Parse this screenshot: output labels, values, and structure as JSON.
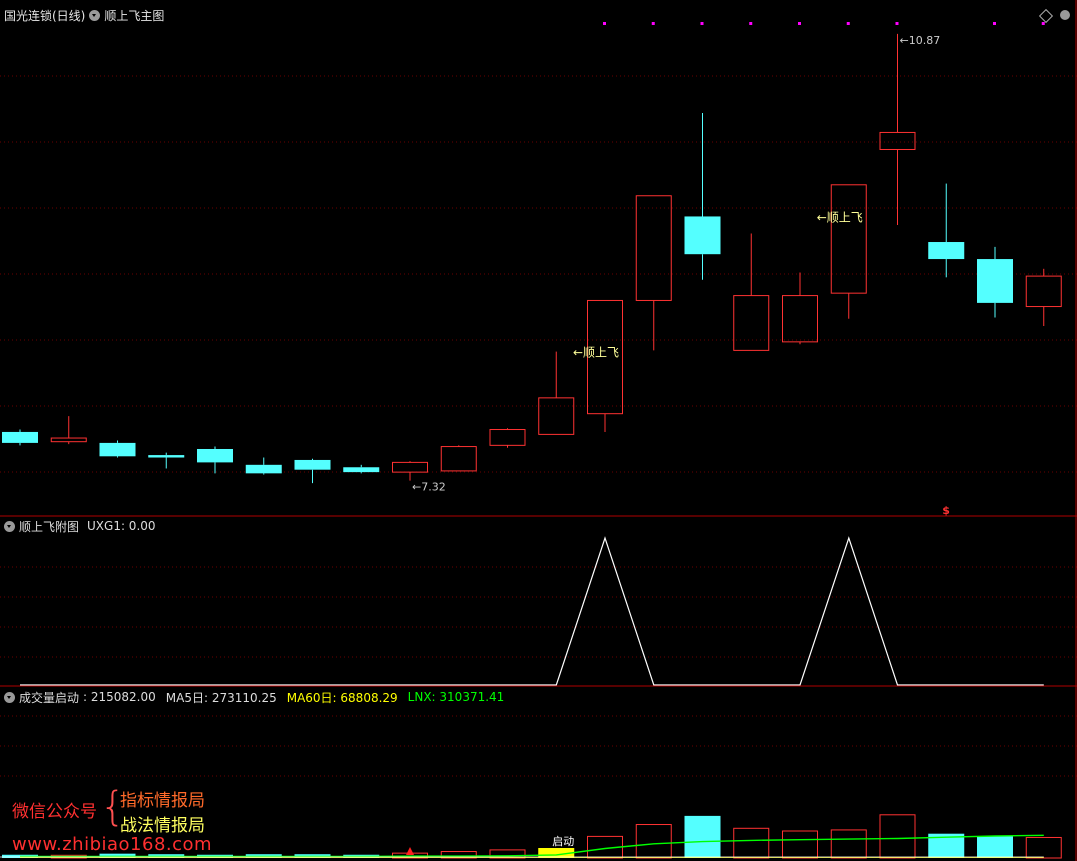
{
  "main_panel": {
    "stock_name": "国光连锁(日线)",
    "indicator_name": "顺上飞主图",
    "high_label": "10.87",
    "low_label": "7.32",
    "signal_label": "顺上飞",
    "dollar_marker": "$"
  },
  "sub_panel": {
    "title": "顺上飞附图",
    "value_text": "UXG1: 0.00"
  },
  "volume_panel": {
    "title": "成交量启动",
    "value": ": 215082.00",
    "ma5": "MA5日: 273110.25",
    "ma60": "MA60日: 68808.29",
    "lnx": "LNX: 310371.41",
    "start_label": "启动"
  },
  "watermark": {
    "wechat_label": "微信公众号",
    "brace": "{",
    "line1": "指标情报局",
    "line2": "战法情报局",
    "url": "www.zhibiao168.com"
  },
  "colors": {
    "background": "#000000",
    "up": "#ff3232",
    "down": "#54ffff",
    "border": "#b00000",
    "grid": "#6a0000",
    "magenta": "#ff00ff",
    "text": "#dddddd",
    "ma60": "#ffff00",
    "lnx": "#00ff00",
    "watermark_red": "#ff3030",
    "watermark_yellow": "#ffff60"
  },
  "chart_data": [
    {
      "type": "candlestick",
      "title": "顺上飞主图",
      "candles": [
        {
          "open": 7.6,
          "close": 7.51,
          "high": 7.62,
          "low": 7.49
        },
        {
          "open": 7.52,
          "close": 7.55,
          "high": 7.73,
          "low": 7.5
        },
        {
          "open": 7.51,
          "close": 7.4,
          "high": 7.53,
          "low": 7.39
        },
        {
          "open": 7.41,
          "close": 7.39,
          "high": 7.43,
          "low": 7.3
        },
        {
          "open": 7.46,
          "close": 7.35,
          "high": 7.48,
          "low": 7.26
        },
        {
          "open": 7.33,
          "close": 7.26,
          "high": 7.39,
          "low": 7.25
        },
        {
          "open": 7.37,
          "close": 7.29,
          "high": 7.38,
          "low": 7.18
        },
        {
          "open": 7.31,
          "close": 7.27,
          "high": 7.33,
          "low": 7.26
        },
        {
          "open": 7.27,
          "close": 7.35,
          "high": 7.36,
          "low": 7.2
        },
        {
          "open": 7.28,
          "close": 7.48,
          "high": 7.49,
          "low": 7.28
        },
        {
          "open": 7.49,
          "close": 7.62,
          "high": 7.63,
          "low": 7.47
        },
        {
          "open": 7.58,
          "close": 7.88,
          "high": 8.26,
          "low": 7.58
        },
        {
          "open": 7.75,
          "close": 8.68,
          "high": 8.68,
          "low": 7.6
        },
        {
          "open": 8.68,
          "close": 9.54,
          "high": 9.54,
          "low": 8.27
        },
        {
          "open": 9.37,
          "close": 9.06,
          "high": 10.22,
          "low": 8.85
        },
        {
          "open": 8.27,
          "close": 8.72,
          "high": 9.23,
          "low": 8.27
        },
        {
          "open": 8.34,
          "close": 8.72,
          "high": 8.91,
          "low": 8.32
        },
        {
          "open": 8.74,
          "close": 9.63,
          "high": 9.63,
          "low": 8.53
        },
        {
          "open": 9.92,
          "close": 10.06,
          "high": 10.87,
          "low": 9.3
        },
        {
          "open": 9.16,
          "close": 9.02,
          "high": 9.64,
          "low": 8.87
        },
        {
          "open": 9.02,
          "close": 8.66,
          "high": 9.12,
          "low": 8.54
        },
        {
          "open": 8.63,
          "close": 8.88,
          "high": 8.94,
          "low": 8.47
        }
      ],
      "annotations": [
        {
          "index": 8,
          "text": "7.32",
          "value": 7.2
        },
        {
          "index": 18,
          "text": "10.87",
          "value": 10.87
        },
        {
          "index": 12,
          "text": "顺上飞",
          "value": 8.26
        },
        {
          "index": 17,
          "text": "顺上飞",
          "value": 9.37
        }
      ],
      "top_marker_indices": [
        12,
        13,
        14,
        15,
        16,
        17,
        18,
        20,
        21
      ],
      "dollar_marker_index": 19
    },
    {
      "type": "line",
      "title": "顺上飞附图",
      "series": [
        {
          "name": "UXG1",
          "values": [
            0,
            0,
            0,
            0,
            0,
            0,
            0,
            0,
            0,
            0,
            0,
            0,
            1,
            0,
            0,
            0,
            0,
            1,
            0,
            0,
            0,
            0
          ]
        }
      ]
    },
    {
      "type": "bar",
      "title": "成交量启动",
      "bars_relative": [
        0.06,
        0.05,
        0.08,
        0.07,
        0.06,
        0.07,
        0.07,
        0.06,
        0.09,
        0.12,
        0.15,
        0.2,
        0.4,
        0.62,
        0.78,
        0.55,
        0.5,
        0.52,
        0.8,
        0.45,
        0.4,
        0.38
      ],
      "bar_colors": [
        "down",
        "up",
        "down",
        "down",
        "down",
        "down",
        "down",
        "down",
        "up",
        "up",
        "up",
        "up",
        "up",
        "up",
        "down",
        "up",
        "up",
        "up",
        "up",
        "down",
        "down",
        "up"
      ],
      "series": [
        {
          "name": "MA60日",
          "values": [
            0.02,
            0.02,
            0.02,
            0.02,
            0.02,
            0.02,
            0.02,
            0.02,
            0.02,
            0.02,
            0.02,
            0.02,
            0.02,
            0.02,
            0.02,
            0.02,
            0.02,
            0.02,
            0.02,
            0.02,
            0.02,
            0.02
          ]
        },
        {
          "name": "LNX",
          "values": [
            0.05,
            0.05,
            0.05,
            0.05,
            0.05,
            0.05,
            0.05,
            0.05,
            0.06,
            0.06,
            0.07,
            0.1,
            0.3,
            0.45,
            0.52,
            0.56,
            0.58,
            0.6,
            0.62,
            0.66,
            0.7,
            0.72
          ]
        }
      ],
      "start_marker_index": 11
    }
  ]
}
